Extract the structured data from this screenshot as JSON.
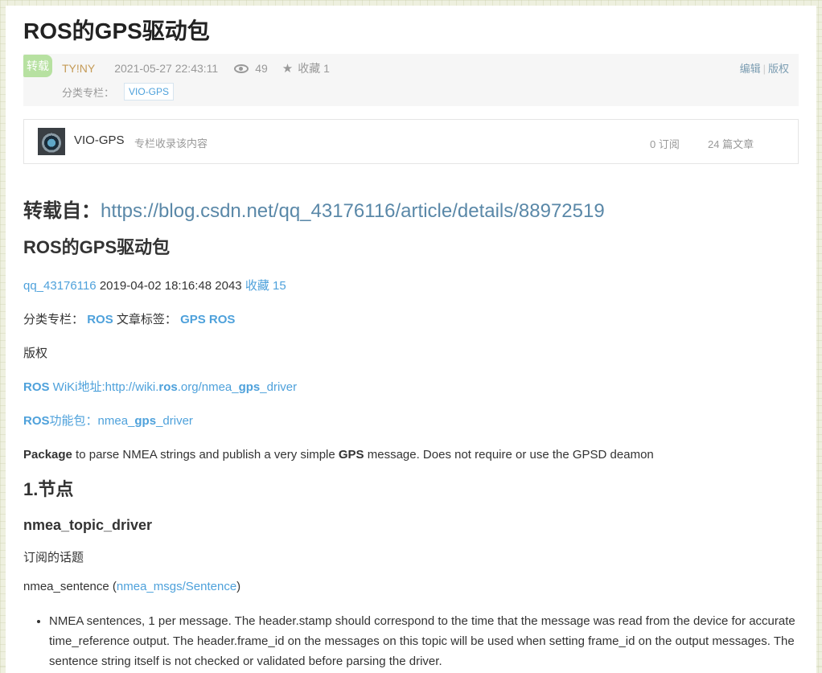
{
  "post": {
    "title": "ROS的GPS驱动包",
    "badge": "转载",
    "author": "TY!NY",
    "datetime": "2021-05-27 22:43:11",
    "views": "49",
    "favorite_label": "收藏 1",
    "edit_label": "编辑",
    "copyright_label": "版权",
    "category_label": "分类专栏：",
    "category_tag": "VIO-GPS"
  },
  "column": {
    "name": "VIO-GPS",
    "desc": "专栏收录该内容",
    "subscriptions": "0 订阅",
    "articles": "24 篇文章"
  },
  "content": {
    "source_prefix": "转载自：",
    "source_url": "https://blog.csdn.net/qq_43176116/article/details/88972519",
    "orig_title": "ROS的GPS驱动包",
    "orig_author": "qq_43176116",
    "orig_date_views": "2019-04-02 18:16:48 2043",
    "orig_fav": "收藏 15",
    "orig_cat_label": "分类专栏：",
    "orig_cat_ros": "ROS",
    "orig_tag_label": "文章标签：",
    "orig_tags": "GPS ROS",
    "orig_copyright": "版权",
    "wiki_ros": "ROS",
    "wiki_prefix": " WiKi地址:http://wiki.",
    "wiki_ros2": "ros",
    "wiki_mid": ".org/nmea_",
    "wiki_gps": "gps",
    "wiki_suffix": "_driver",
    "pkg_ros": "ROS",
    "pkg_prefix": "功能包：nmea_",
    "pkg_gps": "gps",
    "pkg_suffix": "_driver",
    "desc_package": "Package",
    "desc_mid": " to parse NMEA strings and publish a very simple ",
    "desc_gps": "GPS",
    "desc_end": " message. Does not require or use the GPSD deamon",
    "section1": "1.节点",
    "node_name": "nmea_topic_driver",
    "subscribed_label": "订阅的话题",
    "topic_name": "nmea_sentence (",
    "topic_link": "nmea_msgs/Sentence",
    "topic_close": ")",
    "bullet1": "NMEA sentences, 1 per message. The header.stamp should correspond to the time that the message was read from the device for accurate time_reference output. The header.frame_id on the messages on this topic will be used when setting frame_id on the output messages. The sentence string itself is not checked or validated before parsing the driver."
  }
}
